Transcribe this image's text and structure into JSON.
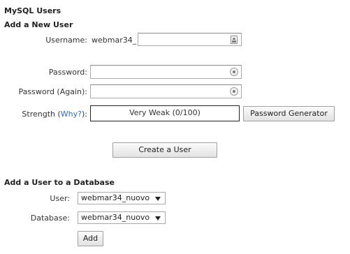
{
  "page": {
    "title": "MySQL Users",
    "add_user_heading": "Add a New User",
    "add_to_db_heading": "Add a User to a Database"
  },
  "new_user_form": {
    "username_label": "Username:",
    "username_prefix": "webmar34_",
    "username_value": "",
    "password_label": "Password:",
    "password_again_label": "Password (Again):",
    "strength_label": "Strength (",
    "strength_link": "Why?",
    "strength_suffix": "):",
    "strength_value": "Very Weak (0/100)",
    "password_generator_button": "Password Generator",
    "create_user_button": "Create a User"
  },
  "add_to_db_form": {
    "user_label": "User:",
    "user_selected": "webmar34_nuovo",
    "database_label": "Database:",
    "database_selected": "webmar34_nuovo",
    "add_button": "Add"
  }
}
